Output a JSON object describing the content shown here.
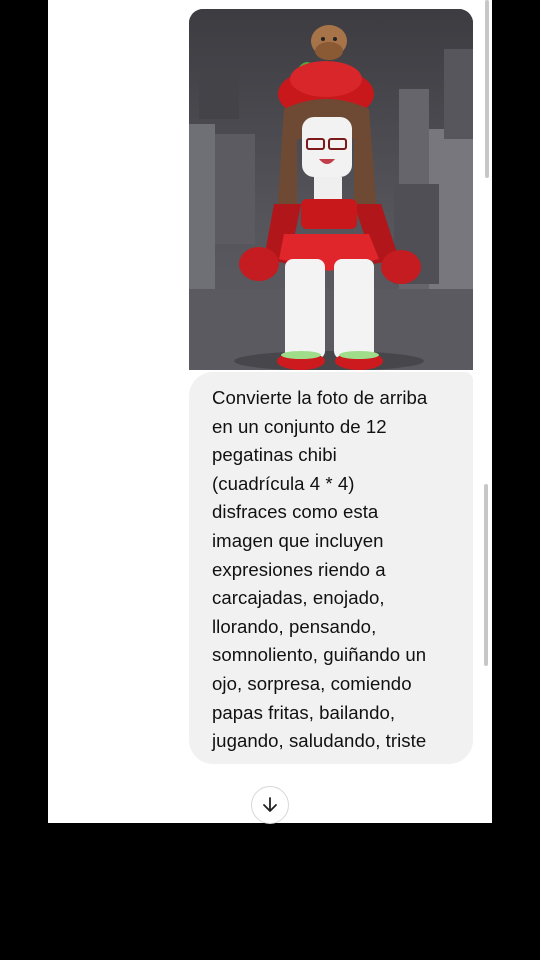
{
  "conversation": {
    "user_image": {
      "alt": "image-avatar-roblox-strawberry-outfit"
    },
    "user_message": "Convierte la foto de arriba\nen un conjunto de 12\npegatinas chibi\n(cuadrícula 4 * 4)\ndisfraces como esta\nimagen que incluyen\nexpresiones riendo a\ncarcajadas, enojado,\nllorando, pensando,\nsomnoliento, guiñando un\nojo, sorpresa, comiendo\npapas fritas, bailando,\njugando, saludando, triste"
  },
  "controls": {
    "scroll_down_icon": "arrow-down-icon"
  },
  "colors": {
    "bubble": "#f1f1f2",
    "text": "#111111",
    "background": "#000000",
    "screen": "#ffffff"
  }
}
